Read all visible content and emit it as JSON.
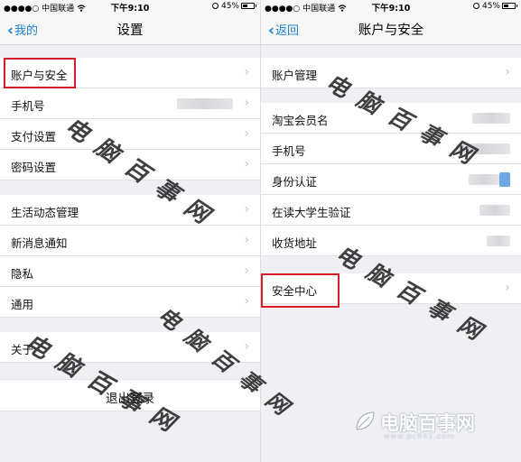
{
  "status_bar": {
    "carrier": "●●●●○ 中国联通 ",
    "time": "下午9:10",
    "battery": "45%"
  },
  "left_screen": {
    "nav": {
      "back_label": "我的",
      "title": "设置"
    },
    "groups": [
      [
        {
          "label": "账户与安全"
        },
        {
          "label": "手机号"
        },
        {
          "label": "支付设置"
        },
        {
          "label": "密码设置"
        }
      ],
      [
        {
          "label": "生活动态管理"
        },
        {
          "label": "新消息通知"
        },
        {
          "label": "隐私"
        },
        {
          "label": "通用"
        }
      ],
      [
        {
          "label": "关于"
        }
      ]
    ],
    "logout_label": "退出登录"
  },
  "right_screen": {
    "nav": {
      "back_label": "返回",
      "title": "账户与安全"
    },
    "groups": [
      [
        {
          "label": "账户管理"
        }
      ],
      [
        {
          "label": "淘宝会员名"
        },
        {
          "label": "手机号"
        },
        {
          "label": "身份认证"
        },
        {
          "label": "在读大学生验证"
        },
        {
          "label": "收货地址"
        }
      ],
      [
        {
          "label": "安全中心"
        }
      ]
    ]
  },
  "watermark": {
    "text": "电脑百事网",
    "logo_text": "电脑百事网",
    "logo_sub": "www.pc841.com"
  },
  "colors": {
    "accent": "#1a80d6",
    "highlight": "#d81c2a",
    "background": "#efeff4"
  },
  "icons": {
    "back": "chevron-left-icon",
    "disclosure": "chevron-right-icon",
    "battery": "battery-icon",
    "orientation_lock": "lock-icon",
    "wifi": "wifi-icon"
  }
}
